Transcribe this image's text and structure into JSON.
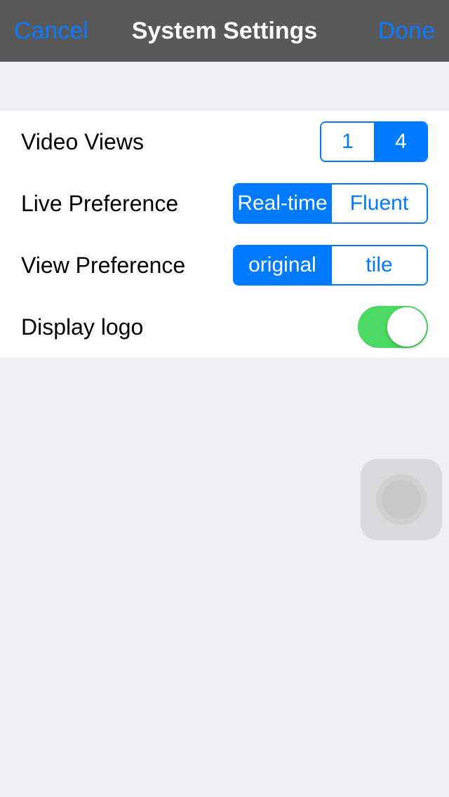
{
  "navbar": {
    "cancel": "Cancel",
    "title": "System Settings",
    "done": "Done"
  },
  "settings": {
    "videoViews": {
      "label": "Video Views",
      "options": [
        "1",
        "4"
      ],
      "selected": "4"
    },
    "livePreference": {
      "label": "Live Preference",
      "options": [
        "Real-time",
        "Fluent"
      ],
      "selected": "Real-time"
    },
    "viewPreference": {
      "label": "View Preference",
      "options": [
        "original",
        "tile"
      ],
      "selected": "original"
    },
    "displayLogo": {
      "label": "Display logo",
      "value": true
    }
  }
}
